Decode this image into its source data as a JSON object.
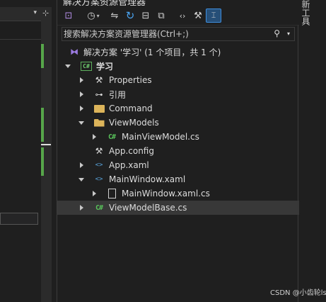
{
  "left": {
    "dropdown_icon": "chevron-down-icon",
    "scroll_icon": "pin-arrow-icon"
  },
  "panel": {
    "title": "解决方案资源管理器",
    "toolbar": [
      {
        "name": "switch-views-button",
        "glyph": "⧉"
      },
      {
        "name": "history-button",
        "glyph": "◷",
        "caret": "▾"
      },
      {
        "name": "sync-button",
        "glyph": "⇋"
      },
      {
        "name": "refresh-button",
        "glyph": "↻"
      },
      {
        "name": "collapse-all-button",
        "glyph": "⊟"
      },
      {
        "name": "show-all-files-button",
        "glyph": "⧉"
      },
      {
        "name": "view-code-button",
        "glyph": "‹›"
      },
      {
        "name": "properties-button",
        "glyph": "🔧"
      },
      {
        "name": "preview-button",
        "glyph": "⌶"
      }
    ],
    "search": {
      "placeholder": "搜索解决方案资源管理器(Ctrl+;)",
      "icon": "search-icon"
    },
    "tree": [
      {
        "label": "解决方案 '学习' (1 个项目，共 1 个)",
        "icon": "solution-icon",
        "expander": "none",
        "level": 0,
        "bold": false
      },
      {
        "label": "学习",
        "icon": "csharp-project-icon",
        "icon_text": "C#",
        "expander": "expanded",
        "level": 1,
        "bold": true
      },
      {
        "label": "Properties",
        "icon": "wrench-icon",
        "expander": "collapsed",
        "level": 2
      },
      {
        "label": "引用",
        "icon": "references-icon",
        "expander": "collapsed",
        "level": 2
      },
      {
        "label": "Command",
        "icon": "folder-icon",
        "expander": "collapsed",
        "level": 2
      },
      {
        "label": "ViewModels",
        "icon": "folder-open-icon",
        "expander": "expanded",
        "level": 2
      },
      {
        "label": "MainViewModel.cs",
        "icon": "csharp-file-icon",
        "icon_text": "C#",
        "expander": "collapsed",
        "level": 3
      },
      {
        "label": "App.config",
        "icon": "config-icon",
        "expander": "none",
        "level": 2
      },
      {
        "label": "App.xaml",
        "icon": "xaml-icon",
        "icon_text": "<>",
        "expander": "collapsed",
        "level": 2
      },
      {
        "label": "MainWindow.xaml",
        "icon": "xaml-icon",
        "icon_text": "<>",
        "expander": "expanded",
        "level": 2
      },
      {
        "label": "MainWindow.xaml.cs",
        "icon": "page-icon",
        "expander": "collapsed",
        "level": 3
      },
      {
        "label": "ViewModelBase.cs",
        "icon": "csharp-file-icon",
        "icon_text": "C#",
        "expander": "collapsed",
        "level": 2,
        "selected": true
      }
    ]
  },
  "right_tab": {
    "label": "新工具"
  },
  "watermark": "CSDN @小齿轮lsl"
}
